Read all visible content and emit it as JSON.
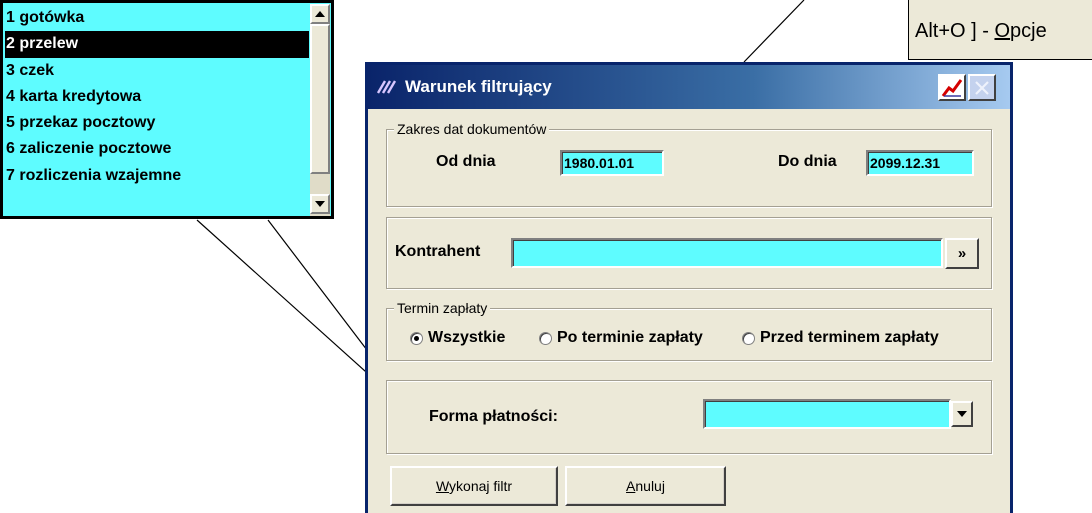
{
  "hint": {
    "prefix": "Alt+O ] - ",
    "accel": "O",
    "rest": "pcje"
  },
  "payment_list": {
    "items": [
      "1 gotówka",
      "2 przelew",
      "3 czek",
      "4 karta kredytowa",
      "5 przekaz pocztowy",
      "6 zaliczenie pocztowe",
      "7 rozliczenia wzajemne"
    ],
    "selected_index": 1,
    "scroll_up_icon": "triangle-up-icon",
    "scroll_down_icon": "triangle-down-icon"
  },
  "dialog": {
    "title": "Warunek filtrujący",
    "app_icon": "app-logo-icon",
    "chart_button_icon": "chart-icon",
    "close_button_icon": "close-icon",
    "date_range": {
      "legend": "Zakres dat dokumentów",
      "from_label": "Od dnia",
      "from_value": "1980.01.01",
      "to_label": "Do dnia",
      "to_value": "2099.12.31"
    },
    "contractor": {
      "label": "Kontrahent",
      "value": "",
      "browse_label": "»"
    },
    "payment_term": {
      "legend": "Termin zapłaty",
      "options": [
        "Wszystkie",
        "Po terminie zapłaty",
        "Przed terminem zapłaty"
      ],
      "selected_index": 0
    },
    "payment_form": {
      "label": "Forma płatności:",
      "value": ""
    },
    "buttons": {
      "execute_accel": "W",
      "execute_rest": "ykonaj filtr",
      "cancel_accel": "A",
      "cancel_rest": "nuluj"
    }
  },
  "colors": {
    "field_bg": "#5efcff",
    "dialog_bg": "#ece9d8",
    "titlebar": "#0a246a"
  }
}
